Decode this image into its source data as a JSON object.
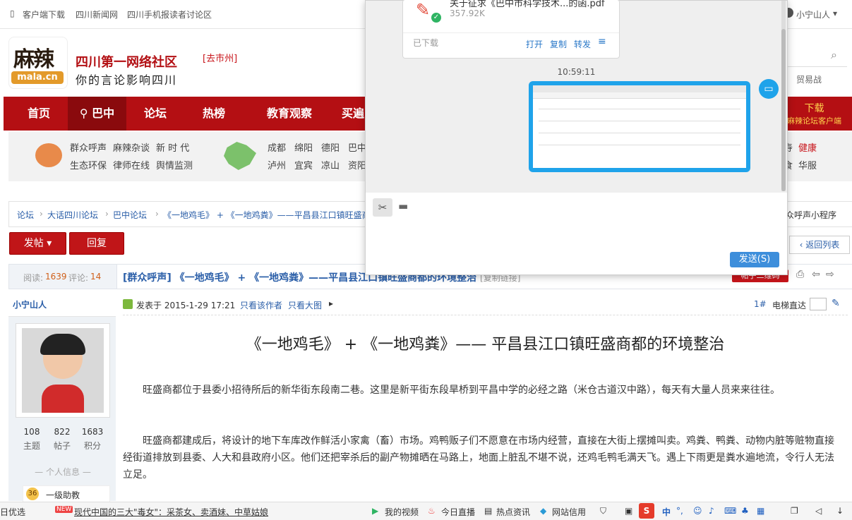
{
  "topbar": {
    "links": [
      "客户端下载",
      "四川新闻网",
      "四川手机报读者讨论区"
    ],
    "user": "小宁山人",
    "trade": "贸易战"
  },
  "header": {
    "logo_big": "麻辣",
    "logo_small": "mala.cn",
    "site_name": "四川第一网络社区",
    "slogan": "你的言论影响四川",
    "city": "[去巿州]"
  },
  "nav": {
    "items": [
      "首页",
      "巴中",
      "论坛",
      "热榜",
      "教育观察",
      "买遍"
    ],
    "download_title": "下载",
    "download_sub": "麻辣论坛客户端"
  },
  "subnav": {
    "row1": [
      "群众呼声",
      "麻辣杂谈",
      "新 时 代"
    ],
    "row2": [
      "生态环保",
      "律师在线",
      "舆情监测"
    ],
    "cities1": [
      "成都",
      "绵阳",
      "德阳",
      "巴中"
    ],
    "cities2": [
      "泸州",
      "宜宾",
      "凉山",
      "资阳"
    ],
    "right1": [
      "寿",
      "健康"
    ],
    "right2": [
      "食",
      "华服"
    ]
  },
  "breadcrumb": {
    "items": [
      "论坛",
      "大话四川论坛",
      "巴中论坛",
      "《一地鸡毛》 + 《一地鸡粪》——平昌县江口镇旺盛商"
    ],
    "right": "众呼声小程序"
  },
  "buttons": {
    "post": "发帖",
    "reply": "回复",
    "back_list": "返回列表"
  },
  "thread": {
    "views_label": "阅读:",
    "views": "1639",
    "comments_label": "评论:",
    "comments": "14",
    "title": "[群众呼声] 《一地鸡毛》 + 《一地鸡粪》——平昌县江口镇旺盛商都的环境整治",
    "copy_link": "[复制链接]",
    "qr_badge": "帖子二维码"
  },
  "author": {
    "name": "小宁山人",
    "stats": [
      {
        "value": "108",
        "label": "主题"
      },
      {
        "value": "822",
        "label": "帖子"
      },
      {
        "value": "1683",
        "label": "积分"
      }
    ],
    "personal_info": "个人信息",
    "level": "一级助教",
    "level_num": "36"
  },
  "post": {
    "posted_at": "发表于 2015-1-29 17:21",
    "only_author": "只看该作者",
    "only_big": "只看大图",
    "floor": "1#",
    "elevator": "电梯直达",
    "heading": "《一地鸡毛》 + 《一地鸡粪》—— 平昌县江口镇旺盛商都的环境整治",
    "paragraphs": [
      "旺盛商都位于县委小招待所后的新华街东段南二巷。这里是新平街东段旱桥到平昌中学的必经之路（米仓古道汉中路），每天有大量人员来来往往。",
      "旺盛商都建成后，将设计的地下车库改作鲜活小家禽（畜）市场。鸡鸭贩子们不愿意在市场内经营，直接在大街上摆摊叫卖。鸡粪、鸭粪、动物内脏等赃物直接经街道排放到县委、人大和县政府小区。他们还把宰杀后的副产物摊晒在马路上，地面上脏乱不堪不说，还鸡毛鸭毛满天飞。遇上下雨更是粪水遍地流，令行人无法立足。"
    ]
  },
  "chat": {
    "file_name": "关于征求《巴中市科学技术...的函.pdf",
    "file_size": "357.92K",
    "file_status": "已下载",
    "actions": [
      "打开",
      "复制",
      "转发"
    ],
    "time": "10:59:11",
    "send": "发送(S)"
  },
  "statusbar": {
    "left": "日优选",
    "new_badge": "NEW",
    "headline": "现代中国的三大\"毒女\"：采茶女、卖酒妹、中草姑娘",
    "items": [
      "我的视频",
      "今日直播",
      "热点资讯",
      "网站信用"
    ],
    "ime": "中"
  }
}
